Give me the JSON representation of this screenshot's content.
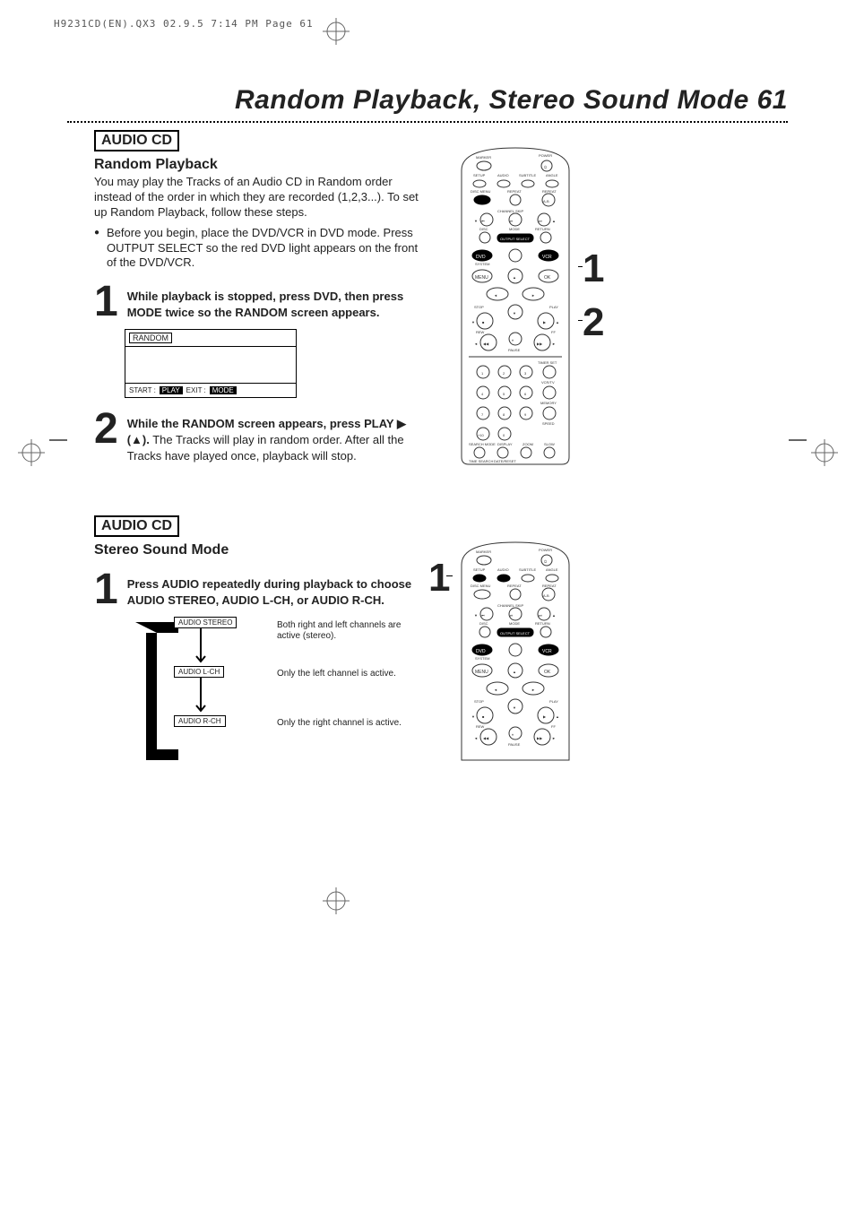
{
  "print_header": "H9231CD(EN).QX3  02.9.5 7:14 PM  Page 61",
  "page_title": "Random Playback, Stereo Sound Mode  61",
  "section1": {
    "label": "AUDIO CD",
    "sub": "Random Playback",
    "intro": "You may play the Tracks of an Audio CD in Random order instead of the order in which they are recorded (1,2,3...). To set up Random Playback, follow these steps.",
    "bullet1": "Before you begin, place the DVD/VCR in DVD mode. Press OUTPUT SELECT so the red DVD light appears on the front of the DVD/VCR.",
    "step1_num": "1",
    "step1_text": "While playback is stopped, press DVD, then press MODE twice so the RANDOM screen appears.",
    "osd": {
      "title": "RANDOM",
      "start": "START :",
      "play": "PLAY",
      "exit": "EXIT :",
      "mode": "MODE"
    },
    "step2_num": "2",
    "step2_bold1": "While the RANDOM screen appears, press PLAY ",
    "step2_sym": "▶",
    "step2_bold2": " (▲).",
    "step2_rest": " The Tracks will play in random order. After all the Tracks have played once, playback will stop."
  },
  "section2": {
    "label": "AUDIO CD",
    "sub": "Stereo Sound Mode",
    "step1_num": "1",
    "step1_text": "Press AUDIO repeatedly during playback to choose AUDIO STEREO, AUDIO L-CH, or AUDIO R-CH.",
    "audio_btn1": "AUDIO STEREO",
    "audio_btn2": "AUDIO L-CH",
    "audio_btn3": "AUDIO R-CH",
    "audio_desc1": "Both right and left channels are active (stereo).",
    "audio_desc2": "Only the left channel is active.",
    "audio_desc3": "Only the right channel is active."
  },
  "callouts": {
    "r1": "1",
    "r2": "2",
    "r3": "1"
  },
  "remote_labels": {
    "power": "POWER",
    "marker": "MARKER",
    "setup": "SETUP",
    "audio": "AUDIO",
    "subtitle": "SUBTITLE",
    "angle": "ANGLE",
    "discmenu": "DISC MENU",
    "repeat": "REPEAT",
    "repeat_ab": "REPEAT",
    "ab": "A-B",
    "chskip": "CHANNEL SKIP",
    "disc": "DISC",
    "mode": "MODE",
    "return": "RETURN",
    "outsel": "OUTPUT SELECT",
    "dvd": "DVD",
    "vcr": "VCR",
    "system": "SYSTEM",
    "menu": "MENU",
    "ok": "OK",
    "stop": "STOP",
    "play": "PLAY",
    "rew": "REW",
    "ff": "FF",
    "pause": "PAUSE",
    "timerset": "TIMER SET",
    "vcrtv": "VCR/TV",
    "memory": "MEMORY",
    "speed": "SPEED",
    "plus10": "+10",
    "searchmode": "SEARCH MODE",
    "display": "DISPLAY",
    "zoom": "ZOOM",
    "slow": "SLOW",
    "timesearch": "TIME SEARCH",
    "datereset": "DATE/RESET",
    "d1": "1",
    "d2": "2",
    "d3": "3",
    "d4": "4",
    "d5": "5",
    "d6": "6",
    "d7": "7",
    "d8": "8",
    "d9": "9",
    "d0": "0"
  }
}
